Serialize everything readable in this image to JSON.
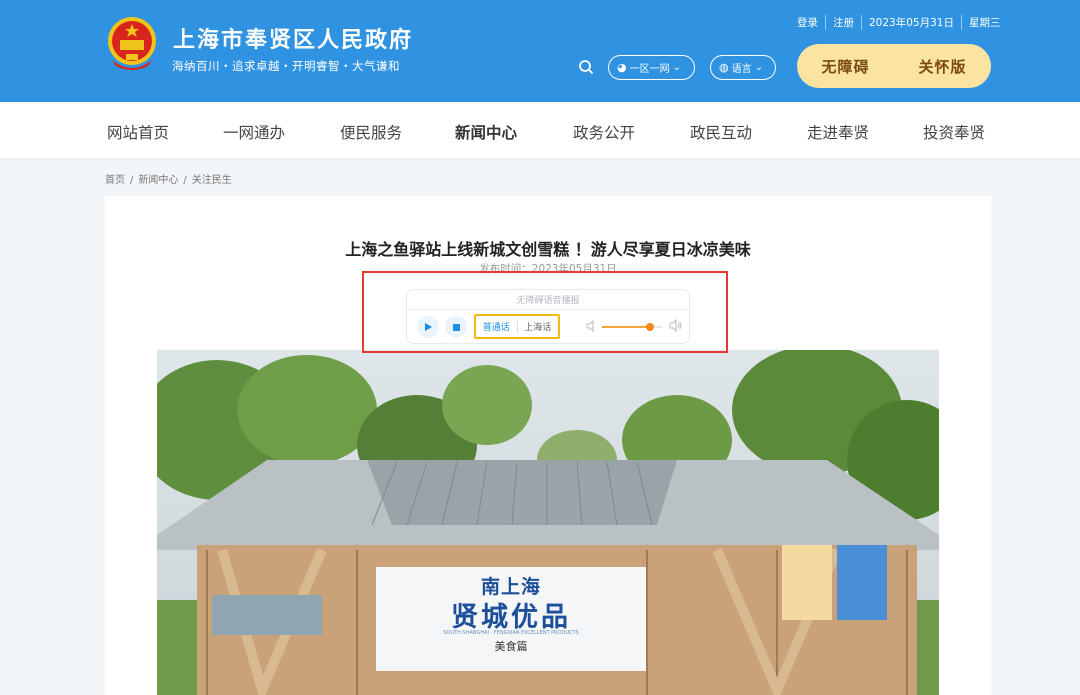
{
  "header": {
    "title": "上海市奉贤区人民政府",
    "slogan": "海纳百川・追求卓越・开明睿智・大气谦和",
    "login": "登录",
    "register": "注册",
    "date": "2023年05月31日",
    "weekday": "星期三",
    "portal_pill": "一区一网",
    "language_pill": "语言",
    "accessibility_btn": "无障碍",
    "elderly_btn": "关怀版"
  },
  "nav": {
    "items": [
      "网站首页",
      "一网通办",
      "便民服务",
      "新闻中心",
      "政务公开",
      "政民互动",
      "走进奉贤",
      "投资奉贤"
    ],
    "active": "新闻中心"
  },
  "breadcrumb": [
    "首页",
    "新闻中心",
    "关注民生"
  ],
  "article": {
    "title": "上海之鱼驿站上线新城文创雪糕 ！游人尽享夏日冰凉美味",
    "pub_date": "发布时间：2023年05月31日"
  },
  "player": {
    "label": "无障碍语音播报",
    "lang_options": [
      "普通话",
      "上海话"
    ],
    "active_lang": "普通话",
    "volume": 0.8
  },
  "photo_sign": {
    "line1": "南上海",
    "line2": "贤城优品",
    "line3": "SOUTH SHANGHAI · FENGXIAN EXCELLENT PRODUCTS",
    "line4": "美食篇"
  },
  "colors": {
    "header_bg": "#2f93e1",
    "accent_btn_bg": "#fbe3a2",
    "accent_btn_text": "#7a4a12",
    "highlight_red": "#e53935",
    "highlight_yellow": "#f2b90f"
  }
}
